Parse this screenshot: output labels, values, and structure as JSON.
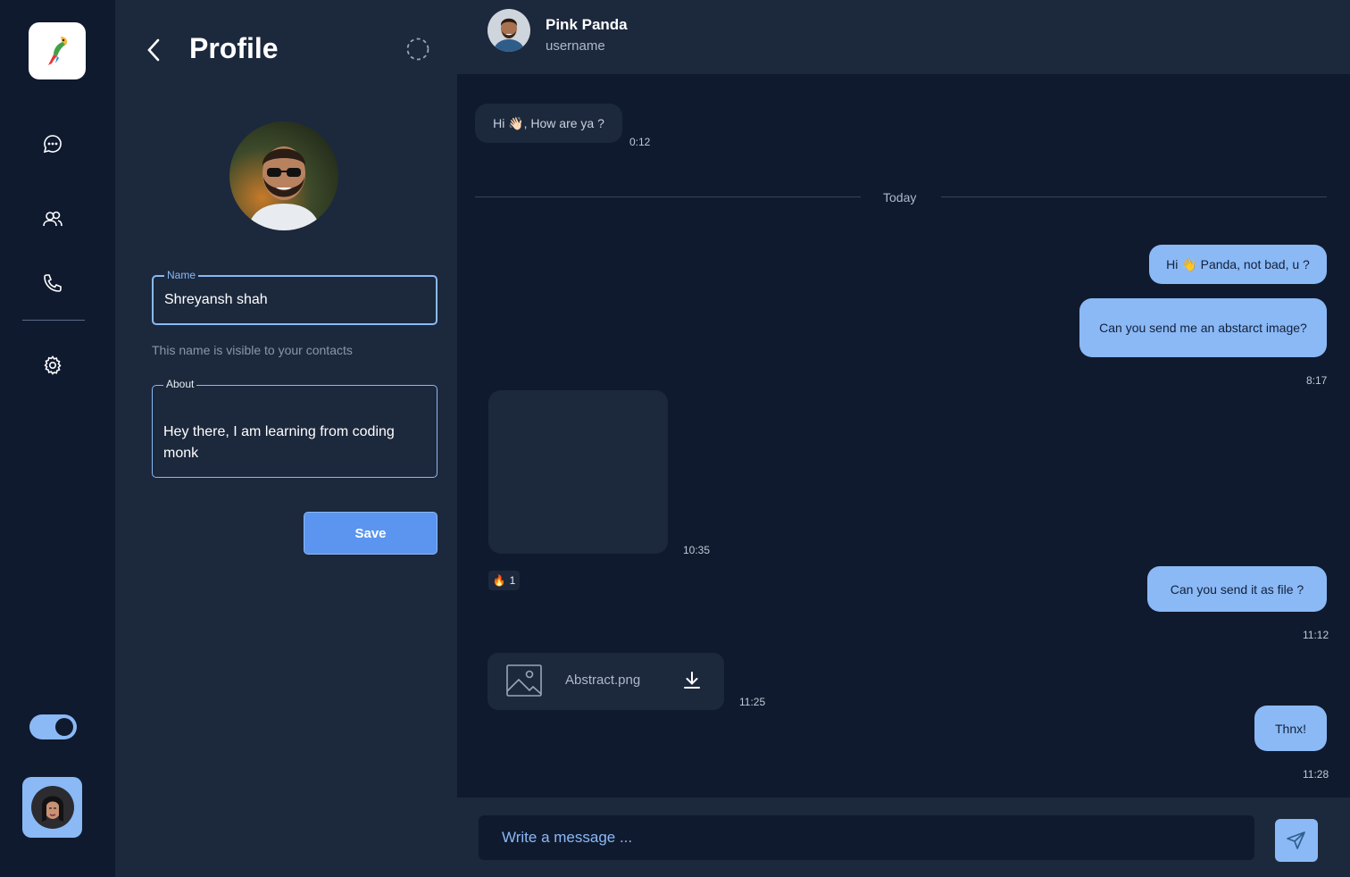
{
  "sidebar": {
    "logo_icon": "parrot-logo-icon",
    "nav_icons": [
      "chat-icon",
      "users-icon",
      "phone-icon",
      "gear-icon"
    ],
    "theme_toggle_on": true,
    "accent": "#8ab9f6"
  },
  "profile": {
    "title": "Profile",
    "name_label": "Name",
    "name_value": "Shreyansh shah",
    "name_helper": "This name is visible to your contacts",
    "about_label": "About",
    "about_value": "Hey there, I am learning from coding monk",
    "save_label": "Save"
  },
  "chat": {
    "contact_name": "Pink Panda",
    "contact_username": "username",
    "divider": "Today",
    "messages": [
      {
        "text": "Hi 👋🏻, How are ya ?",
        "time": "0:12"
      },
      {
        "text": "Hi 👋 Panda, not bad, u ?"
      },
      {
        "text": "Can you send me an abstarct image?",
        "time": "8:17"
      },
      {
        "time": "10:35"
      },
      {
        "text": "Can you send it as file ?",
        "time": "11:12"
      },
      {
        "text": "Abstract.png",
        "time": "11:25"
      },
      {
        "text": "Thnx!",
        "time": "11:28"
      }
    ],
    "reaction_emoji": "🔥",
    "reaction_count": "1",
    "input_placeholder": "Write a message ..."
  }
}
